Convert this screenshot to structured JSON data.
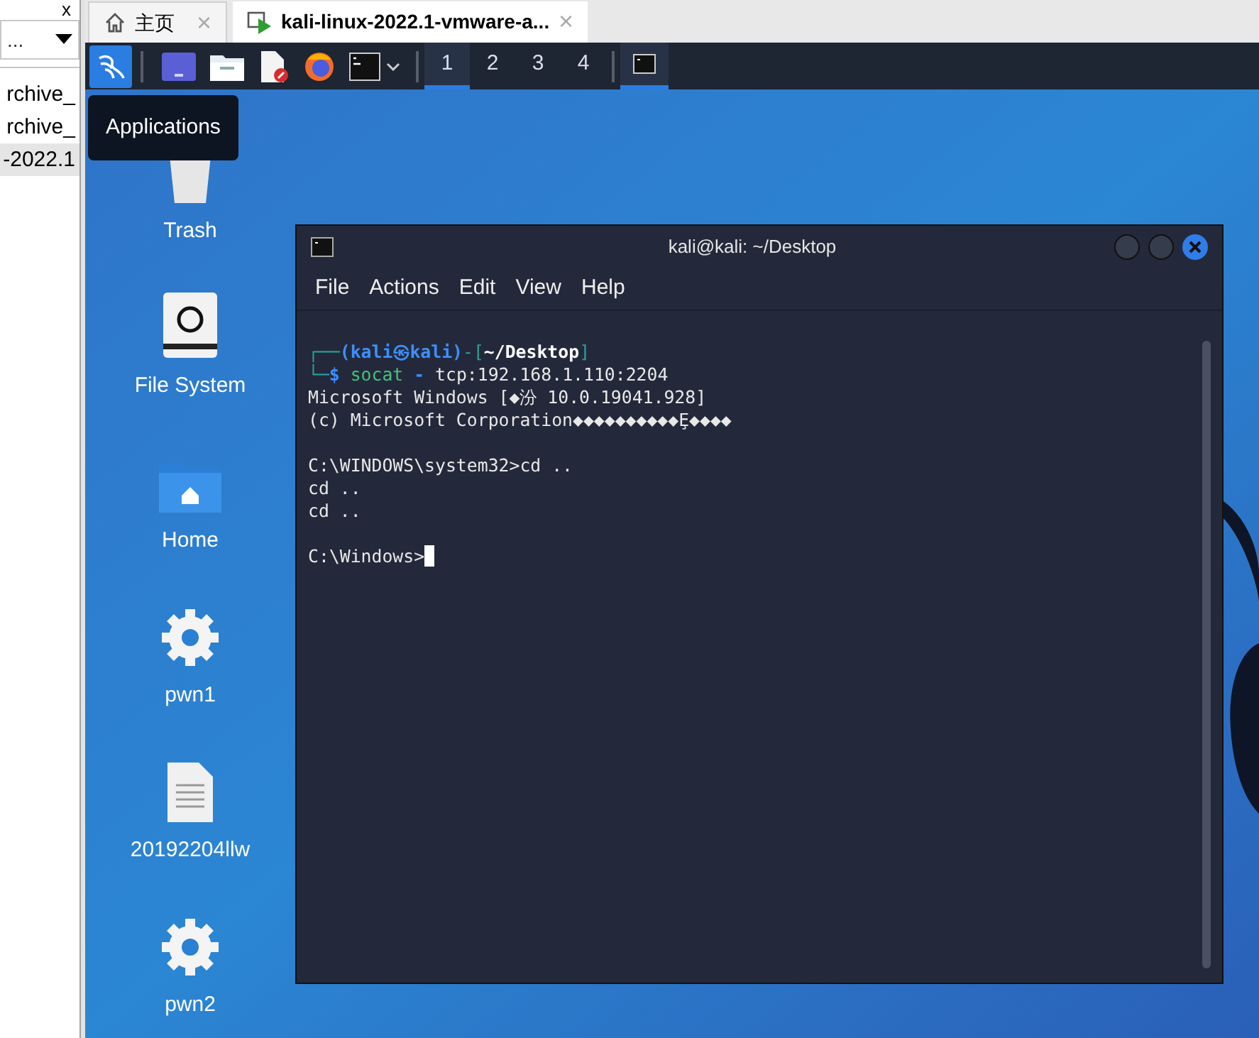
{
  "left_panel": {
    "close": "x",
    "dropdown": "...",
    "items": [
      {
        "label": "rchive_",
        "selected": false
      },
      {
        "label": "rchive_",
        "selected": false
      },
      {
        "label": "-2022.1",
        "selected": true
      }
    ]
  },
  "vm_tabs": [
    {
      "label": "主页",
      "kind": "home",
      "selected": false,
      "close": "×"
    },
    {
      "label": "kali-linux-2022.1-vmware-a...",
      "kind": "vm",
      "selected": true,
      "close": "×"
    }
  ],
  "panel": {
    "launchers": [
      {
        "kind": "logo"
      },
      {
        "kind": "desktop"
      },
      {
        "kind": "folder"
      },
      {
        "kind": "editor"
      },
      {
        "kind": "browser"
      },
      {
        "kind": "terminal"
      }
    ],
    "workspaces": [
      {
        "label": "1",
        "selected": true
      },
      {
        "label": "2",
        "selected": false
      },
      {
        "label": "3",
        "selected": false
      },
      {
        "label": "4",
        "selected": false
      }
    ],
    "tasks": [
      {
        "kind": "terminal",
        "selected": true
      }
    ]
  },
  "tooltip": "Applications",
  "desktop_icons": [
    {
      "label": "Trash",
      "kind": "trash"
    },
    {
      "label": "File System",
      "kind": "drive"
    },
    {
      "label": "Home",
      "kind": "home"
    },
    {
      "label": "pwn1",
      "kind": "gear"
    },
    {
      "label": "20192204llw",
      "kind": "file"
    },
    {
      "label": "pwn2",
      "kind": "gear"
    }
  ],
  "terminal": {
    "title": "kali@kali: ~/Desktop",
    "menu": [
      "File",
      "Actions",
      "Edit",
      "View",
      "Help"
    ],
    "blocks": [
      [
        [
          {
            "text": "┌──",
            "kind": "frame"
          },
          {
            "text": "(kali㉿kali)",
            "kind": "user"
          },
          {
            "text": "-[",
            "kind": "frame"
          },
          {
            "text": "~/Desktop",
            "kind": "path"
          },
          {
            "text": "]",
            "kind": "frame"
          }
        ],
        [
          {
            "text": "└─",
            "kind": "frame"
          },
          {
            "text": "$ ",
            "kind": "user"
          },
          {
            "text": "socat",
            "kind": "cmd"
          },
          {
            "text": " - ",
            "kind": "user"
          },
          {
            "text": "tcp:192.168.1.110:2204",
            "kind": "plain"
          }
        ],
        [
          {
            "text": "Microsoft Windows [◆汾 10.0.19041.928]",
            "kind": "plain"
          }
        ],
        [
          {
            "text": "(c) Microsoft Corporation◆◆◆◆◆◆◆◆◆◆Ȩ◆◆◆◆",
            "kind": "plain"
          }
        ]
      ],
      [
        [
          {
            "text": "C:\\WINDOWS\\system32>cd ..",
            "kind": "plain"
          }
        ],
        [
          {
            "text": "cd ..",
            "kind": "plain"
          }
        ],
        [
          {
            "text": "cd ..",
            "kind": "plain"
          }
        ]
      ],
      [
        [
          {
            "text": "C:\\Windows>",
            "kind": "plain"
          },
          {
            "kind": "cursor"
          }
        ]
      ]
    ]
  }
}
